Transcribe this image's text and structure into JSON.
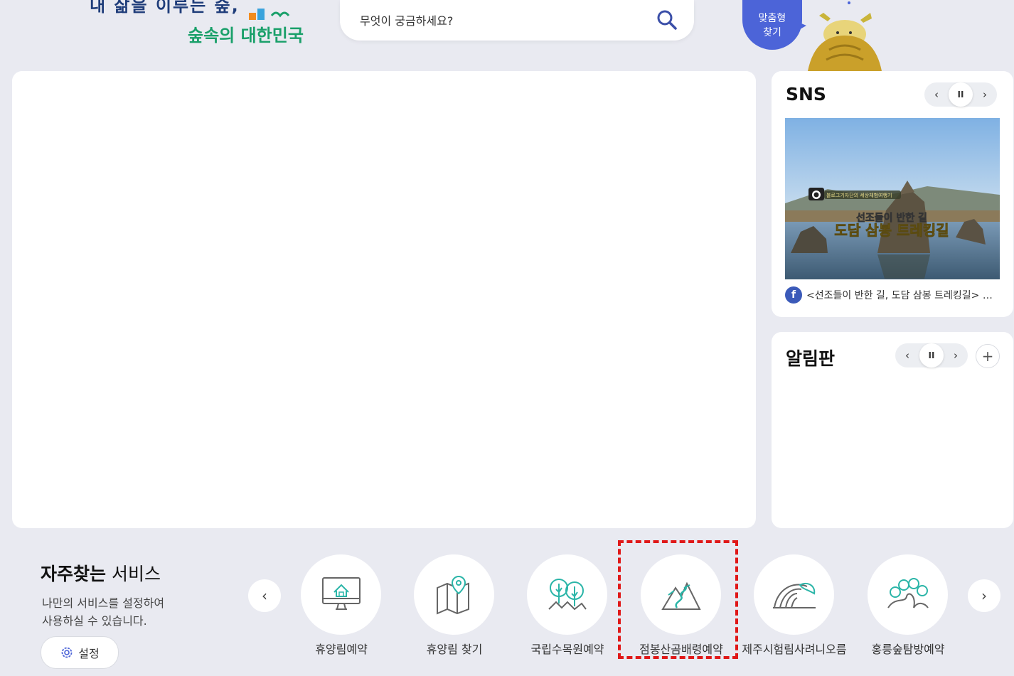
{
  "header": {
    "logo_line1": "내 삶을 이루는 숲,",
    "logo_line2": "숲속의 대한민국",
    "search_placeholder": "무엇이 궁금하세요?",
    "custom_find_line1": "맞춤형",
    "custom_find_line2": "찾기"
  },
  "sns": {
    "title": "SNS",
    "image_badge": "블로그기자단의 세상체험여행기",
    "image_title_line1": "선조들이 반한 길",
    "image_title_line2": "도담 삼봉 트레킹길",
    "caption": "<선조들이 반한 길, 도담 삼봉 트레킹길> 하...",
    "fb_letter": "f",
    "prev": "‹",
    "pause": "II",
    "next": "›"
  },
  "notice": {
    "title": "알림판",
    "prev": "‹",
    "pause": "II",
    "next": "›",
    "more": "+"
  },
  "favorites": {
    "title_bold": "자주찾는",
    "title_light": " 서비스",
    "desc_line1": "나만의 서비스를 설정하여",
    "desc_line2": "사용하실 수 있습니다.",
    "settings_label": "설정",
    "prev": "‹",
    "next": "›",
    "items": [
      {
        "label": "휴양림예약",
        "icon": "monitor-house-icon"
      },
      {
        "label": "휴양림 찾기",
        "icon": "map-pin-icon"
      },
      {
        "label": "국립수목원예약",
        "icon": "trees-icon"
      },
      {
        "label": "점봉산곰배령예약",
        "icon": "mountain-icon"
      },
      {
        "label": "제주시험림사려니오름",
        "icon": "dome-icon"
      },
      {
        "label": "홍릉숲탐방예약",
        "icon": "forest-path-icon"
      }
    ]
  },
  "colors": {
    "accent_blue": "#4c64d8",
    "icon_teal": "#2bb5a8",
    "highlight_red": "#e01818"
  }
}
